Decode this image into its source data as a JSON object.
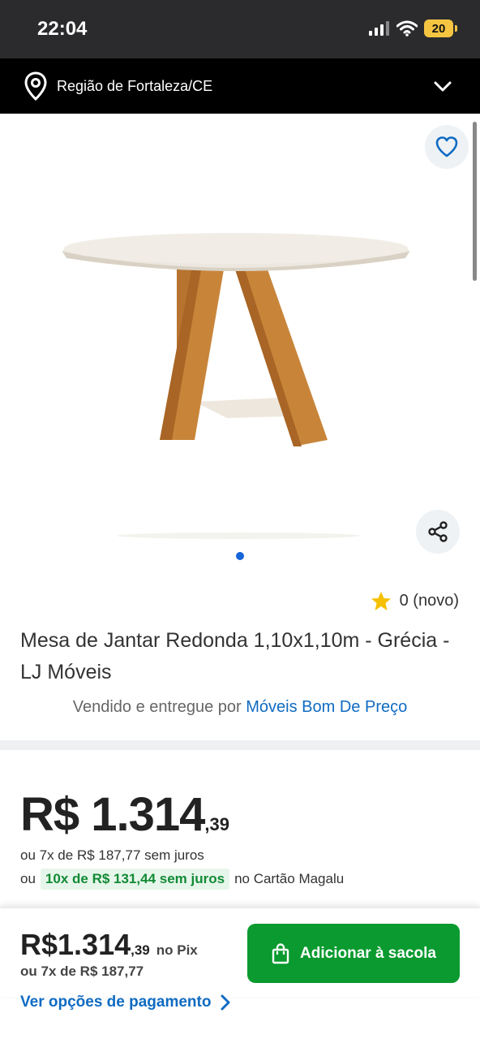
{
  "status": {
    "time": "22:04",
    "battery": "20"
  },
  "region": {
    "label": "Região de Fortaleza/CE"
  },
  "product": {
    "rating_text": "0 (novo)",
    "title": "Mesa de Jantar Redonda 1,10x1,10m - Grécia - LJ Móveis",
    "seller_prefix": "Vendido e entregue por",
    "seller_name": "Móveis Bom De Preço"
  },
  "pricing": {
    "price_main": "R$ 1.314",
    "price_cents": ",39",
    "installments_line": "ou 7x de R$ 187,77 sem juros",
    "card_prefix": "ou",
    "card_offer": "10x de R$ 131,44 sem juros",
    "card_suffix": "no Cartão Magalu"
  },
  "bottom_bar": {
    "price_main": "R$1.314",
    "price_cents": ",39",
    "pix_label": "no Pix",
    "installments": "ou 7x de R$ 187,77",
    "add_button_label": "Adicionar à sacola",
    "payment_link": "Ver opções de pagamento"
  },
  "colors": {
    "accent_blue": "#0f6bc2",
    "button_green": "#0a9a2f",
    "badge_green": "#138a36",
    "star": "#f5c000"
  }
}
